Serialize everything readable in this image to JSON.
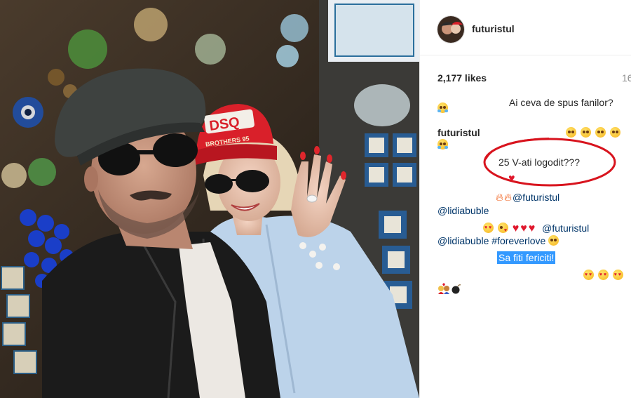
{
  "post": {
    "username": "futuristul",
    "likes": "2,177 likes",
    "likes_partial": "16"
  },
  "comments": {
    "question": "Ai ceva de spus fanilor?",
    "commenter": "futuristul",
    "logodit": "25 V-ati logodit???",
    "mention_1": "@futuristul",
    "mention_2": "@lidiabuble",
    "mention_3": "@futuristul",
    "mention_4": "@lidiabuble",
    "hashtag": "#foreverlove",
    "congrats": "Sa fiti fericiti!"
  },
  "icons": {
    "avatar": "profile-avatar",
    "laughing": "face-with-tears-of-joy",
    "thinking": "thinking-face",
    "heart_eyes": "smiling-face-with-heart-eyes",
    "heart": "red-heart",
    "fire": "fire",
    "kiss": "face-blowing-kiss",
    "smile": "slightly-smiling-face",
    "couple": "couple-with-heart",
    "bomb": "bomb"
  },
  "colors": {
    "mention": "#003569",
    "highlight": "#3399ff",
    "annotation": "#d8141e",
    "hat": "#d9202a"
  },
  "photo": {
    "cap_brand": "DSQ",
    "cap_line": "BROTHERS 95"
  }
}
